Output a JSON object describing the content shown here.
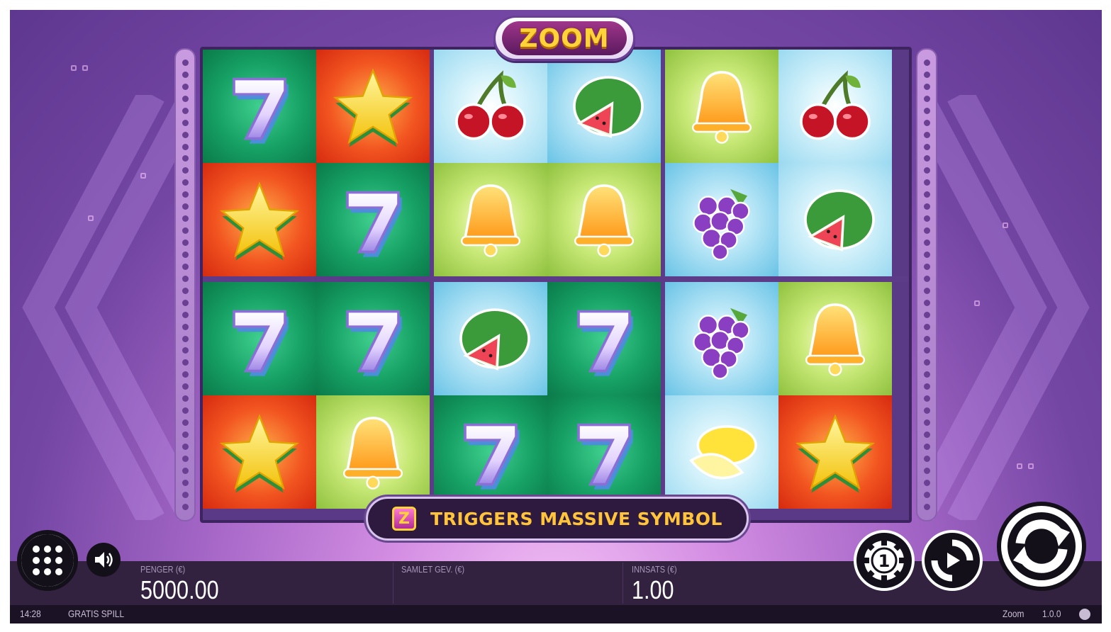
{
  "game": {
    "logo": "ZOOM",
    "banner_badge": "Z",
    "banner_text": "TRIGGERS MASSIVE SYMBOL",
    "grid": [
      [
        "seven-green",
        "star-red",
        "cherry-ltblue",
        "watermelon-blue",
        "bell-lime",
        "cherry-ltblue"
      ],
      [
        "star-red",
        "seven-green",
        "bell-lime",
        "bell-lime",
        "grapes-blue",
        "watermelon-ltblue"
      ],
      [
        "seven-green",
        "seven-green",
        "watermelon-blue",
        "seven-green",
        "grapes-blue",
        "bell-lime"
      ],
      [
        "star-red",
        "bell-lime",
        "seven-green",
        "seven-green",
        "lemon-ltblue",
        "star-red"
      ]
    ]
  },
  "hud": {
    "balance_label": "PENGER (€)",
    "balance_value": "5000.00",
    "win_label": "SAMLET GEV. (€)",
    "win_value": "",
    "bet_label": "INNSATS (€)",
    "bet_value": "1.00",
    "bet_chip_value": "1"
  },
  "status": {
    "time": "14:28",
    "mode": "GRATIS SPILL",
    "game_name": "Zoom",
    "version": "1.0.0"
  },
  "colors": {
    "accent_gold": "#ffc43a",
    "bar_bg": "#32213f",
    "frame_purple": "#5e3790"
  }
}
